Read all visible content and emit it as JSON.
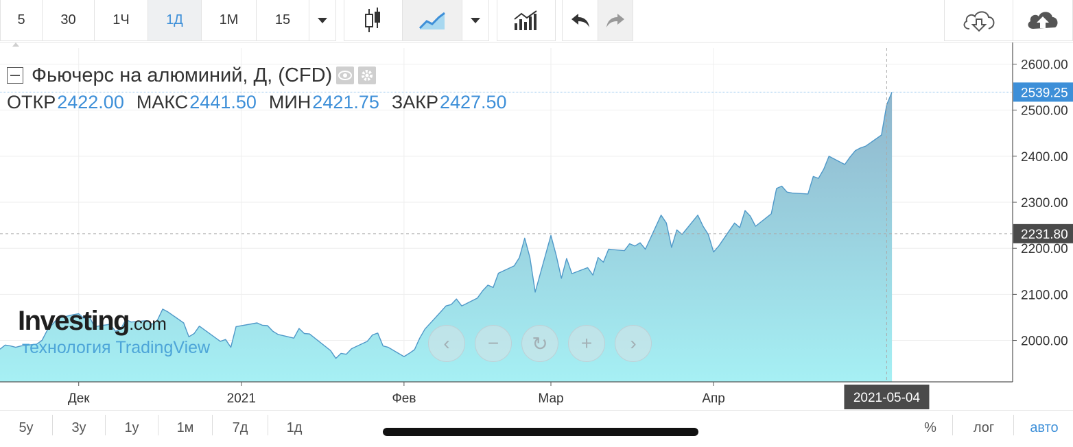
{
  "toolbar": {
    "intervals": [
      "5",
      "30",
      "1Ч",
      "1Д",
      "1М",
      "15"
    ],
    "active_interval": "1Д"
  },
  "legend": {
    "title": "Фьючерс на алюминий, Д, (CFD)",
    "ohlc": [
      {
        "label": "ОТКР",
        "value": "2422.00"
      },
      {
        "label": "МАКС",
        "value": "2441.50"
      },
      {
        "label": "МИН",
        "value": "2421.75"
      },
      {
        "label": "ЗАКР",
        "value": "2427.50"
      }
    ]
  },
  "watermark": {
    "brand": "Investing",
    "brand_suffix": ".com",
    "subtitle": "технология TradingView"
  },
  "colors": {
    "line": "#4f98c8",
    "fill_top": "#8fb5cc",
    "fill_bottom": "#a6f0f4",
    "accent": "#3d8fd8",
    "crosshair_tag": "#4a4a4a"
  },
  "chart_data": {
    "type": "area",
    "title": "Фьючерс на алюминий, Д, (CFD)",
    "xlabel": "",
    "ylabel": "",
    "ylim": [
      1910,
      2635
    ],
    "yticks": [
      2000,
      2100,
      2200,
      2300,
      2400,
      2500,
      2600
    ],
    "ytick_labels": [
      "2000.00",
      "2100.00",
      "2200.00",
      "2300.00",
      "2400.00",
      "2500.00",
      "2600.00"
    ],
    "xticks": [
      {
        "label": "Дек",
        "date": "2020-12-01"
      },
      {
        "label": "2021",
        "date": "2021-01-01"
      },
      {
        "label": "Фев",
        "date": "2021-02-01"
      },
      {
        "label": "Мар",
        "date": "2021-03-01"
      },
      {
        "label": "Апр",
        "date": "2021-04-01"
      }
    ],
    "xlim": [
      "2020-11-16",
      "2021-05-28"
    ],
    "last_price": "2539.25",
    "crosshair_price": "2231.80",
    "crosshair_date": "2021-05-04",
    "series": [
      {
        "points": [
          [
            "2020-11-16",
            1981
          ],
          [
            "2020-11-17",
            1990
          ],
          [
            "2020-11-18",
            1988
          ],
          [
            "2020-11-19",
            1985
          ],
          [
            "2020-11-20",
            1988
          ],
          [
            "2020-11-23",
            1992
          ],
          [
            "2020-11-24",
            2000
          ],
          [
            "2020-11-25",
            2022
          ],
          [
            "2020-11-26",
            2035
          ],
          [
            "2020-11-27",
            2048
          ],
          [
            "2020-11-30",
            2056
          ],
          [
            "2020-12-01",
            2058
          ],
          [
            "2020-12-02",
            2048
          ],
          [
            "2020-12-03",
            2052
          ],
          [
            "2020-12-04",
            2030
          ],
          [
            "2020-12-07",
            2035
          ],
          [
            "2020-12-08",
            2020
          ],
          [
            "2020-12-09",
            2025
          ],
          [
            "2020-12-10",
            2045
          ],
          [
            "2020-12-11",
            2040
          ],
          [
            "2020-12-14",
            2043
          ],
          [
            "2020-12-15",
            2035
          ],
          [
            "2020-12-16",
            2044
          ],
          [
            "2020-12-17",
            2068
          ],
          [
            "2020-12-18",
            2062
          ],
          [
            "2020-12-21",
            2038
          ],
          [
            "2020-12-22",
            2008
          ],
          [
            "2020-12-23",
            2015
          ],
          [
            "2020-12-24",
            2031
          ],
          [
            "2020-12-28",
            1998
          ],
          [
            "2020-12-29",
            2002
          ],
          [
            "2020-12-30",
            1985
          ],
          [
            "2020-12-31",
            2030
          ],
          [
            "2021-01-04",
            2038
          ],
          [
            "2021-01-05",
            2033
          ],
          [
            "2021-01-06",
            2032
          ],
          [
            "2021-01-07",
            2020
          ],
          [
            "2021-01-08",
            2013
          ],
          [
            "2021-01-11",
            2005
          ],
          [
            "2021-01-12",
            2026
          ],
          [
            "2021-01-13",
            2015
          ],
          [
            "2021-01-14",
            2014
          ],
          [
            "2021-01-15",
            2005
          ],
          [
            "2021-01-18",
            1978
          ],
          [
            "2021-01-19",
            1961
          ],
          [
            "2021-01-20",
            1972
          ],
          [
            "2021-01-21",
            1970
          ],
          [
            "2021-01-22",
            1982
          ],
          [
            "2021-01-25",
            1998
          ],
          [
            "2021-01-26",
            2012
          ],
          [
            "2021-01-27",
            2016
          ],
          [
            "2021-01-28",
            1988
          ],
          [
            "2021-01-29",
            1985
          ],
          [
            "2021-02-01",
            1965
          ],
          [
            "2021-02-02",
            1972
          ],
          [
            "2021-02-03",
            1980
          ],
          [
            "2021-02-04",
            2005
          ],
          [
            "2021-02-05",
            2025
          ],
          [
            "2021-02-08",
            2062
          ],
          [
            "2021-02-09",
            2075
          ],
          [
            "2021-02-10",
            2078
          ],
          [
            "2021-02-11",
            2090
          ],
          [
            "2021-02-12",
            2075
          ],
          [
            "2021-02-15",
            2092
          ],
          [
            "2021-02-16",
            2108
          ],
          [
            "2021-02-17",
            2120
          ],
          [
            "2021-02-18",
            2115
          ],
          [
            "2021-02-19",
            2146
          ],
          [
            "2021-02-22",
            2162
          ],
          [
            "2021-02-23",
            2180
          ],
          [
            "2021-02-24",
            2222
          ],
          [
            "2021-02-25",
            2180
          ],
          [
            "2021-02-26",
            2105
          ],
          [
            "2021-03-01",
            2228
          ],
          [
            "2021-03-02",
            2185
          ],
          [
            "2021-03-03",
            2135
          ],
          [
            "2021-03-04",
            2178
          ],
          [
            "2021-03-05",
            2145
          ],
          [
            "2021-03-08",
            2158
          ],
          [
            "2021-03-09",
            2142
          ],
          [
            "2021-03-10",
            2180
          ],
          [
            "2021-03-11",
            2170
          ],
          [
            "2021-03-12",
            2198
          ],
          [
            "2021-03-15",
            2195
          ],
          [
            "2021-03-16",
            2210
          ],
          [
            "2021-03-17",
            2205
          ],
          [
            "2021-03-18",
            2212
          ],
          [
            "2021-03-19",
            2198
          ],
          [
            "2021-03-22",
            2272
          ],
          [
            "2021-03-23",
            2255
          ],
          [
            "2021-03-24",
            2202
          ],
          [
            "2021-03-25",
            2240
          ],
          [
            "2021-03-26",
            2230
          ],
          [
            "2021-03-29",
            2272
          ],
          [
            "2021-03-30",
            2248
          ],
          [
            "2021-03-31",
            2230
          ],
          [
            "2021-04-01",
            2192
          ],
          [
            "2021-04-02",
            2205
          ],
          [
            "2021-04-05",
            2255
          ],
          [
            "2021-04-06",
            2245
          ],
          [
            "2021-04-07",
            2282
          ],
          [
            "2021-04-08",
            2270
          ],
          [
            "2021-04-09",
            2248
          ],
          [
            "2021-04-12",
            2275
          ],
          [
            "2021-04-13",
            2330
          ],
          [
            "2021-04-14",
            2335
          ],
          [
            "2021-04-15",
            2322
          ],
          [
            "2021-04-16",
            2320
          ],
          [
            "2021-04-19",
            2318
          ],
          [
            "2021-04-20",
            2356
          ],
          [
            "2021-04-21",
            2352
          ],
          [
            "2021-04-22",
            2372
          ],
          [
            "2021-04-23",
            2400
          ],
          [
            "2021-04-26",
            2382
          ],
          [
            "2021-04-27",
            2398
          ],
          [
            "2021-04-28",
            2412
          ],
          [
            "2021-04-29",
            2418
          ],
          [
            "2021-04-30",
            2422
          ],
          [
            "2021-05-03",
            2446
          ],
          [
            "2021-05-04",
            2512
          ],
          [
            "2021-05-05",
            2539.25
          ]
        ]
      }
    ]
  },
  "nav_controls": [
    "‹",
    "−",
    "↻",
    "+",
    "›"
  ],
  "range_buttons": [
    "5у",
    "3у",
    "1у",
    "1м",
    "7д",
    "1д"
  ],
  "scale_buttons": [
    "%",
    "лог",
    "авто"
  ]
}
